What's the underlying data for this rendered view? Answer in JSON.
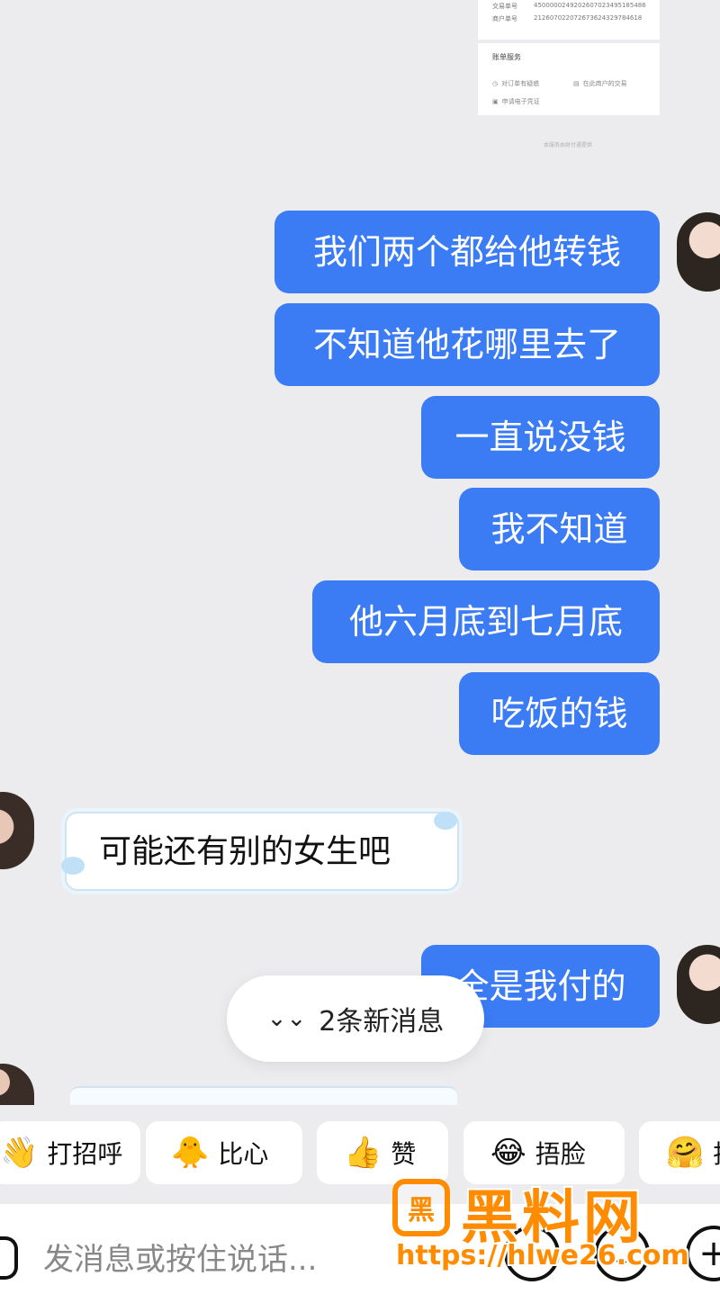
{
  "receipt": {
    "rows": [
      {
        "label": "交易单号",
        "value": "4500000249202607023495185486"
      },
      {
        "label": "商户单号",
        "value": "21260702207267362432978461​8"
      }
    ],
    "section_title": "账单服务",
    "actions": [
      "对订单有疑惑",
      "在此商户的交易",
      "申请电子凭证"
    ],
    "footer_note": "本服务由财付通提供"
  },
  "messages_sent": [
    "我们两个都给他转钱",
    "不知道他花哪里去了",
    "一直说没钱",
    "我不知道",
    "他六月底到七月底",
    "吃饭的钱",
    "全是我付的"
  ],
  "message_received": "可能还有别的女生吧",
  "new_messages_pill": {
    "icon": "double-chevron-down-icon",
    "label": "2条新消息"
  },
  "quick_replies": [
    {
      "emoji": "👋",
      "label": "打招呼"
    },
    {
      "emoji": "🐥",
      "label": "比心"
    },
    {
      "emoji": "👍",
      "label": "赞"
    },
    {
      "emoji": "😂",
      "label": "捂脸"
    },
    {
      "emoji": "🤗",
      "label": "抱"
    }
  ],
  "input": {
    "placeholder": "发消息或按住说话..."
  },
  "watermark": {
    "logo": "黑",
    "text": "黑料网",
    "url": "https://hlwe26.com"
  },
  "colors": {
    "sent_bubble": "#3b7cf5",
    "background": "#ececee",
    "watermark": "#ff8c00"
  }
}
